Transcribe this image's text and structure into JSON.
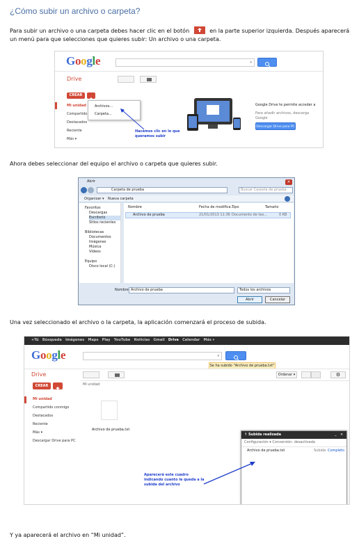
{
  "heading": "¿Cómo subir un archivo o carpeta?",
  "para1a": "Para subir un archivo o una carpeta debes hacer clic en el botón",
  "para1b": "en la parte superior izquierda. Después aparecerá un menú para que selecciones que quieres subir: Un archivo o una carpeta.",
  "para2": "Ahora debes seleccionar del equipo el archivo o carpeta que quieres subir.",
  "para3": "Una vez seleccionado el archivo o la carpeta, la aplicación comenzará el proceso de subida.",
  "para4": "Y ya aparecerá el archivo en “Mi unidad”.",
  "colors": {
    "red": "#d14836",
    "blue": "#4d8ef0",
    "heading": "#4a6fa5"
  },
  "s1": {
    "logo": [
      "G",
      "o",
      "o",
      "g",
      "l",
      "e"
    ],
    "drive": "Drive",
    "crear": "CREAR",
    "nav": [
      "Mi unidad",
      "Compartido c",
      "Destacados",
      "Reciente",
      "Más ▾"
    ],
    "menu": [
      "Archivos...",
      "Carpeta..."
    ],
    "annot": "Hacemos clic en lo que queramos subir",
    "promo_title": "Google Drive te permite acceder a",
    "promo_sub": "Para añadir archivos, descarga Google",
    "promo_btn": "Descargar Drive para PC"
  },
  "s2": {
    "title": "Abrir",
    "path": "Carpeta de prueba",
    "search_ph": "Buscar Carpeta de prueba",
    "organizar": "Organizar ▾",
    "nueva": "Nueva carpeta",
    "cols": [
      "Nombre",
      "Fecha de modifica...",
      "Tipo",
      "Tamaño"
    ],
    "file": {
      "name": "Archivo de prueba",
      "date": "21/01/2013 11:36",
      "type": "Documento de tex...",
      "size": "0 KB"
    },
    "tree": [
      "Favoritos",
      "Descargas",
      "Escritorio",
      "Sitios recientes",
      "Bibliotecas",
      "Documentos",
      "Imágenes",
      "Música",
      "Vídeos",
      "Equipo",
      "Disco local (C:)"
    ],
    "nombre_label": "Nombre:",
    "nombre_val": "Archivo de prueba",
    "filter": "Todos los archivos",
    "abrir": "Abrir",
    "cancelar": "Cancelar"
  },
  "s3": {
    "topbar": [
      "+Tú",
      "Búsqueda",
      "Imágenes",
      "Maps",
      "Play",
      "YouTube",
      "Noticias",
      "Gmail",
      "Drive",
      "Calendar",
      "Más ▾"
    ],
    "toast": "Se ha subido \"Archivo de prueba.txt\"",
    "drive": "Drive",
    "crear": "CREAR",
    "crumb": "Mi unidad",
    "ordenar": "Ordenar ▾",
    "nav": [
      "Mi unidad",
      "Compartido conmigo",
      "Destacados",
      "Reciente",
      "Más ▾",
      "Descargar Drive para PC"
    ],
    "file": "Archivo de prueba.txt",
    "panel_title": "Subida realizada",
    "panel_sub": "Configuración ▾ Conversión: desactivada",
    "panel_file": "Archivo de prueba.txt",
    "panel_act": "Subida",
    "panel_done": "Completo",
    "annot": "Aparecerá este cuadro indicando cuanto le queda a la subida del archivo"
  }
}
